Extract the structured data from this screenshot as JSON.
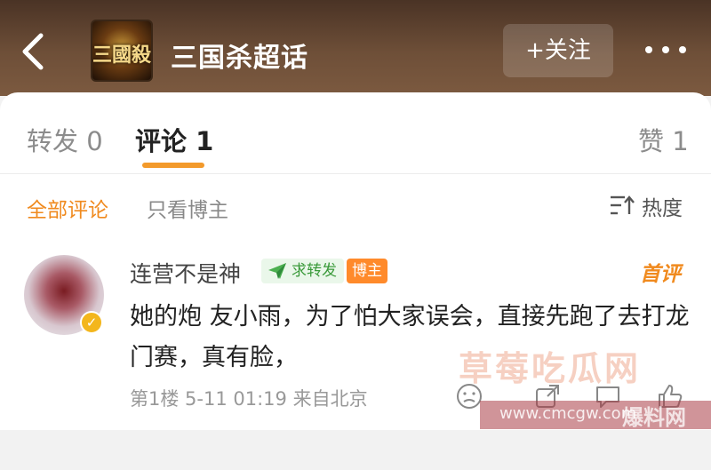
{
  "header": {
    "title": "三国杀超话",
    "logo_text": "三國殺",
    "follow_label": "+关注"
  },
  "tabs": [
    {
      "label": "转发 0"
    },
    {
      "label": "评论 1"
    },
    {
      "label": "赞 1"
    }
  ],
  "filters": {
    "all": "全部评论",
    "owner_only": "只看博主",
    "sort_label": "热度"
  },
  "comment": {
    "username": "连营不是神",
    "badge_forward": "求转发",
    "badge_owner": "博主",
    "first_label": "首评",
    "text": "她的炮 友小雨，为了怕大家误会，直接先跑了去打龙门赛，真有脸，",
    "meta": "第1楼 5-11 01:19 来自北京"
  },
  "watermark": {
    "main": "草莓吃瓜网",
    "url": "www.cmcgw.com",
    "tag": "爆料网"
  },
  "colors": {
    "accent": "#f08a1e",
    "header_bg": "#6e4f38",
    "badge_green": "#3a9a3a",
    "badge_owner": "#ff8a2b"
  }
}
